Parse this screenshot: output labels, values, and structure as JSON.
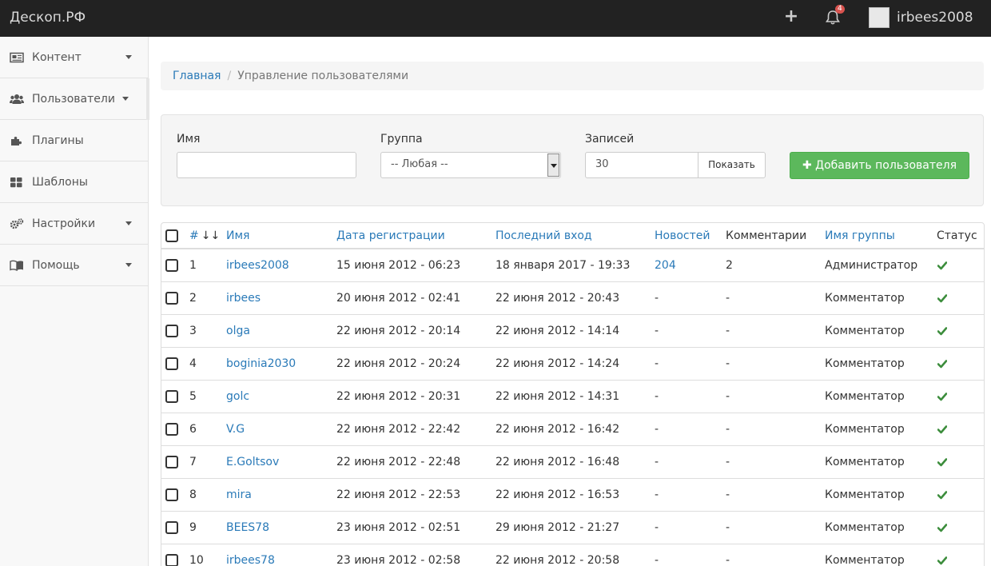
{
  "topbar": {
    "brand": "Дескоп.РФ",
    "plus_glyph": "+",
    "notifications_count": "4",
    "username": "irbees2008",
    "icons": {
      "plus": "plus-icon",
      "bell": "bell-icon",
      "avatar": "avatar-image"
    }
  },
  "sidebar": {
    "items": [
      {
        "label": "Контент",
        "icon": "newspaper-icon",
        "has_caret": true
      },
      {
        "label": "Пользователи",
        "icon": "users-icon",
        "has_caret": true,
        "active": true
      },
      {
        "label": "Плагины",
        "icon": "puzzle-icon",
        "has_caret": false
      },
      {
        "label": "Шаблоны",
        "icon": "grid-icon",
        "has_caret": false
      },
      {
        "label": "Настройки",
        "icon": "gears-icon",
        "has_caret": true
      },
      {
        "label": "Помощь",
        "icon": "book-icon",
        "has_caret": true
      }
    ]
  },
  "breadcrumb": {
    "home": "Главная",
    "separator": "/",
    "current": "Управление пользователями"
  },
  "filter": {
    "name_label": "Имя",
    "name_value": "",
    "group_label": "Группа",
    "group_selected": "-- Любая --",
    "records_label": "Записей",
    "records_value": "30",
    "show_button": "Показать",
    "add_button": "Добавить пользователя",
    "add_glyph": "✚"
  },
  "table": {
    "columns": {
      "num": "#",
      "sort_glyph": "↓↓",
      "name": "Имя",
      "reg": "Дата регистрации",
      "last": "Последний вход",
      "news": "Новостей",
      "comments": "Комментарии",
      "group": "Имя группы",
      "status": "Статус"
    },
    "rows": [
      {
        "id": "1",
        "name": "irbees2008",
        "reg": "15 июня 2012 - 06:23",
        "last": "18 января 2017 - 19:33",
        "news": "204",
        "comments": "2",
        "group": "Администратор"
      },
      {
        "id": "2",
        "name": "irbees",
        "reg": "20 июня 2012 - 02:41",
        "last": "22 июня 2012 - 20:43",
        "news": "-",
        "comments": "-",
        "group": "Комментатор"
      },
      {
        "id": "3",
        "name": "olga",
        "reg": "22 июня 2012 - 20:14",
        "last": "22 июня 2012 - 14:14",
        "news": "-",
        "comments": "-",
        "group": "Комментатор"
      },
      {
        "id": "4",
        "name": "boginia2030",
        "reg": "22 июня 2012 - 20:24",
        "last": "22 июня 2012 - 14:24",
        "news": "-",
        "comments": "-",
        "group": "Комментатор"
      },
      {
        "id": "5",
        "name": "golc",
        "reg": "22 июня 2012 - 20:31",
        "last": "22 июня 2012 - 14:31",
        "news": "-",
        "comments": "-",
        "group": "Комментатор"
      },
      {
        "id": "6",
        "name": "V.G",
        "reg": "22 июня 2012 - 22:42",
        "last": "22 июня 2012 - 16:42",
        "news": "-",
        "comments": "-",
        "group": "Комментатор"
      },
      {
        "id": "7",
        "name": "E.Goltsov",
        "reg": "22 июня 2012 - 22:48",
        "last": "22 июня 2012 - 16:48",
        "news": "-",
        "comments": "-",
        "group": "Комментатор"
      },
      {
        "id": "8",
        "name": "mira",
        "reg": "22 июня 2012 - 22:53",
        "last": "22 июня 2012 - 16:53",
        "news": "-",
        "comments": "-",
        "group": "Комментатор"
      },
      {
        "id": "9",
        "name": "BEES78",
        "reg": "23 июня 2012 - 02:51",
        "last": "29 июня 2012 - 21:27",
        "news": "-",
        "comments": "-",
        "group": "Комментатор"
      },
      {
        "id": "10",
        "name": "irbees78",
        "reg": "23 июня 2012 - 02:58",
        "last": "22 июня 2012 - 20:58",
        "news": "-",
        "comments": "-",
        "group": "Комментатор"
      }
    ]
  },
  "colors": {
    "topbar_bg": "#222222",
    "link": "#2a7ab8",
    "success": "#5cb85c",
    "status_check": "#3c8d3c",
    "badge": "#d9534f"
  }
}
